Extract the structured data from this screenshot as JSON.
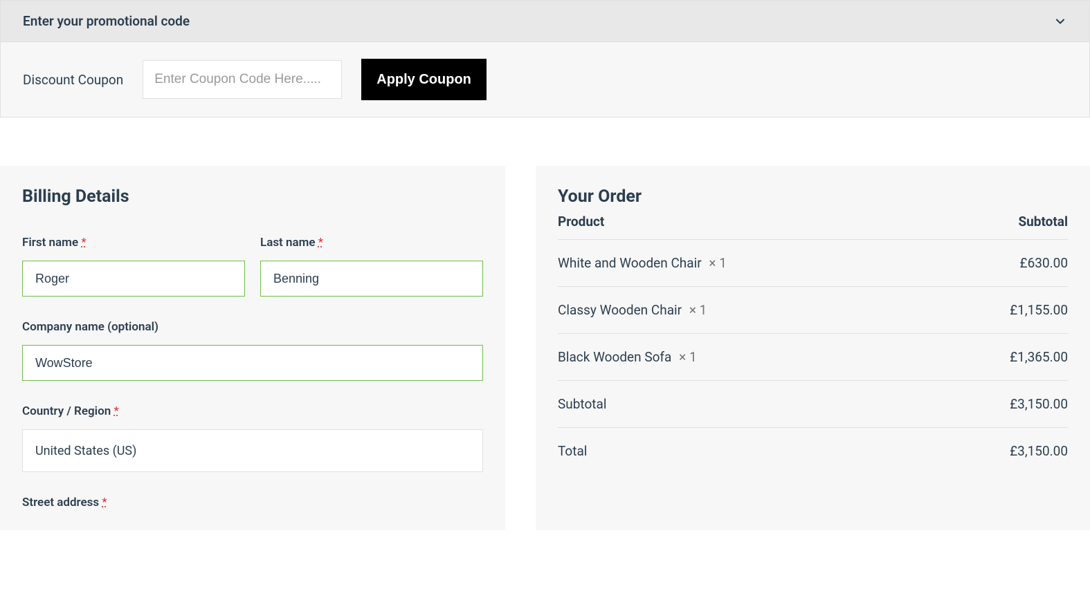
{
  "promo": {
    "header_text": "Enter your promotional code",
    "discount_label": "Discount Coupon",
    "coupon_placeholder": "Enter Coupon Code Here.....",
    "apply_button": "Apply Coupon"
  },
  "billing": {
    "title": "Billing Details",
    "fields": {
      "first_name": {
        "label": "First name",
        "required": "*",
        "value": "Roger"
      },
      "last_name": {
        "label": "Last name",
        "required": "*",
        "value": "Benning"
      },
      "company": {
        "label": "Company name (optional)",
        "value": "WowStore"
      },
      "country": {
        "label": "Country / Region",
        "required": "*",
        "value": "United States (US)"
      },
      "street": {
        "label": "Street address",
        "required": "*"
      }
    }
  },
  "order": {
    "title": "Your Order",
    "header_product": "Product",
    "header_subtotal": "Subtotal",
    "items": [
      {
        "name": "White and Wooden Chair",
        "qty": "× 1",
        "price": "£630.00"
      },
      {
        "name": "Classy Wooden Chair",
        "qty": "× 1",
        "price": "£1,155.00"
      },
      {
        "name": "Black Wooden Sofa",
        "qty": "× 1",
        "price": "£1,365.00"
      }
    ],
    "subtotal_label": "Subtotal",
    "subtotal_value": "£3,150.00",
    "total_label": "Total",
    "total_value": "£3,150.00"
  }
}
